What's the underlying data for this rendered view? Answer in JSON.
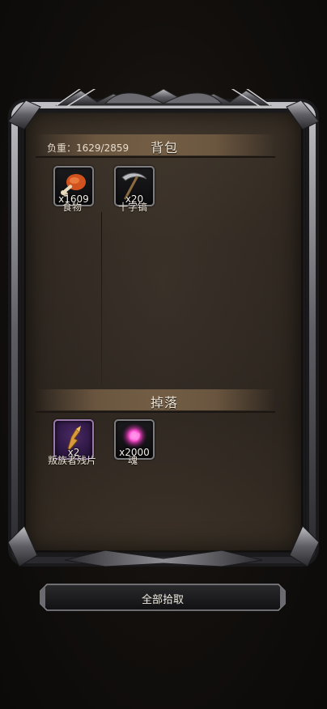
{
  "backpack": {
    "title": "背包",
    "weight_text": "负重：1629/2859",
    "items": [
      {
        "name": "食物",
        "count": "x1609",
        "icon": "chicken-leg-icon"
      },
      {
        "name": "十字镐",
        "count": "x20",
        "icon": "pickaxe-icon"
      }
    ]
  },
  "drops": {
    "title": "掉落",
    "items": [
      {
        "name": "叛族者残片",
        "count": "x2",
        "icon": "fragment-icon"
      },
      {
        "name": "魂",
        "count": "x2000",
        "icon": "soul-icon"
      }
    ]
  },
  "actions": {
    "pickup_all": "全部拾取"
  },
  "colors": {
    "panel_bg": "#3b322a",
    "section_bar": "#76604a",
    "slot_border": "#7d7d80",
    "drop_slot_bg": "#2b1640"
  }
}
